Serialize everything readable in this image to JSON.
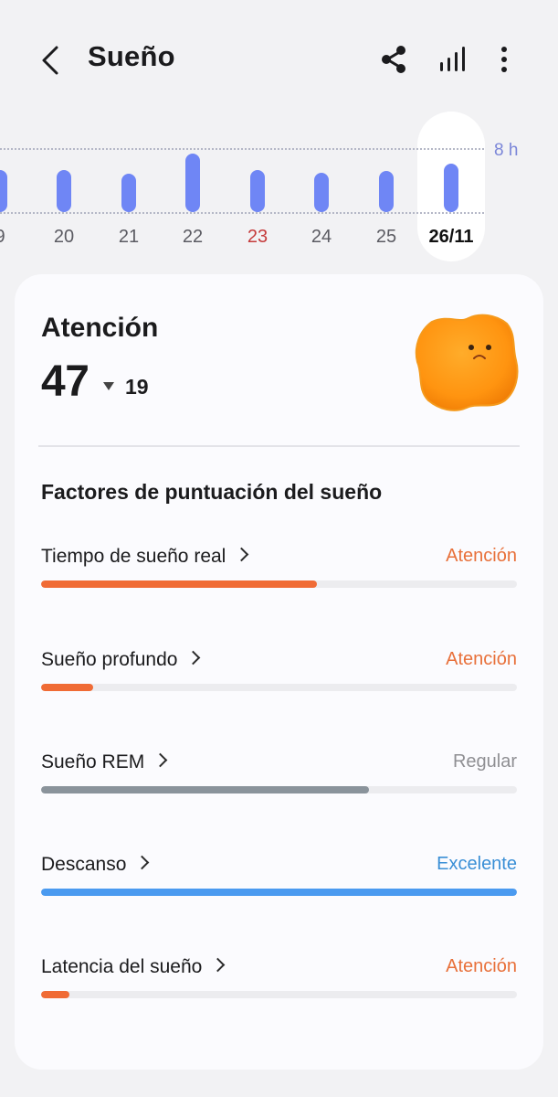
{
  "header": {
    "title": "Sueño",
    "back_icon": "chevron-left-icon",
    "share_icon": "share-icon",
    "stats_icon": "bar-chart-icon",
    "more_icon": "more-vertical-icon"
  },
  "chart_data": {
    "type": "bar",
    "categories": [
      "9",
      "20",
      "21",
      "22",
      "23",
      "24",
      "25",
      "26/11"
    ],
    "values": [
      7.0,
      7.0,
      6.4,
      9.8,
      7.0,
      6.6,
      6.8,
      8.1
    ],
    "reference_label": "8 h",
    "reference_value": 8,
    "selected": "26/11",
    "highlight_categories": [
      "23"
    ],
    "bar_color": "#6f86f5",
    "ylim": [
      0,
      10
    ]
  },
  "summary": {
    "status": "Atención",
    "score": "47",
    "delta": "19",
    "delta_direction": "down",
    "mascot_icon": "orange-fluffy-mascot-icon"
  },
  "factors_title": "Factores de puntuación del sueño",
  "factors": [
    {
      "label": "Tiempo de sueño real",
      "status": "Atención",
      "progress": 0.58,
      "color": "#f06b35",
      "status_color": "#e8703a"
    },
    {
      "label": "Sueño profundo",
      "status": "Atención",
      "progress": 0.11,
      "color": "#f06b35",
      "status_color": "#e8703a"
    },
    {
      "label": "Sueño REM",
      "status": "Regular",
      "progress": 0.69,
      "color": "#8a939b",
      "status_color": "#8f8f93"
    },
    {
      "label": "Descanso",
      "status": "Excelente",
      "progress": 1.0,
      "color": "#4a9af0",
      "status_color": "#3a8fd6"
    },
    {
      "label": "Latencia del sueño",
      "status": "Atención",
      "progress": 0.06,
      "color": "#f06b35",
      "status_color": "#e8703a"
    }
  ]
}
